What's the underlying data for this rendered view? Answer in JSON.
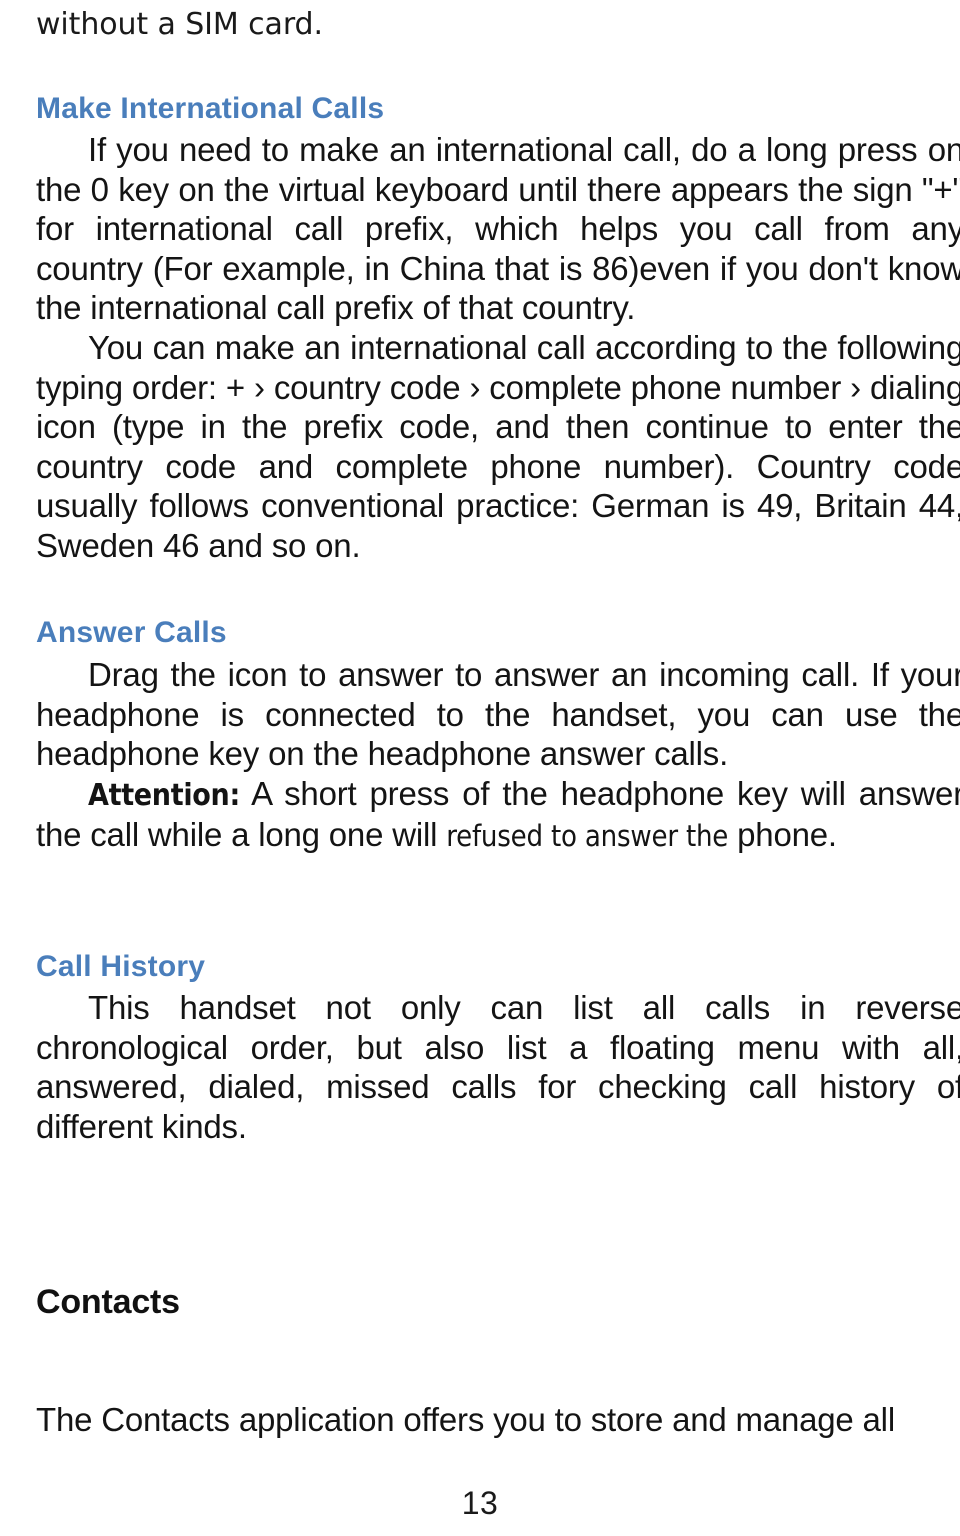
{
  "document": {
    "page_number": "13",
    "heading_color": "#4a7ebb",
    "body_color": "#141414",
    "background_color": "#ffffff"
  },
  "content": {
    "orphan_line": "without a SIM card.",
    "sections": [
      {
        "id": "make-international-calls",
        "heading": "Make International Calls",
        "heading_style": "blue",
        "paragraphs": [
          "If you need to make an international call, do a long press on the 0 key on the virtual keyboard until there appears the sign \"+\" for international call prefix, which helps you call from any country (For example, in China that is 86)even if you don't know the international call prefix of that country.",
          "You can make an international call according to the following typing order: + › country code › complete phone number › dialing icon (type in the prefix code, and then continue to enter the country code and complete phone number). Country code usually follows conventional practice: German is 49, Britain 44, Sweden 46 and so on."
        ]
      },
      {
        "id": "answer-calls",
        "heading": "Answer Calls",
        "heading_style": "blue",
        "paragraphs": [
          "Drag the icon to answer to answer an incoming call. If your headphone is connected to the handset, you can use the headphone key on the headphone answer calls."
        ],
        "attention": {
          "label": "Attention:",
          "text_run_1": " A short press of the headphone key will answer the call while a long one will ",
          "text_run_soft": "refused to answer the",
          "text_run_2": " phone."
        }
      },
      {
        "id": "call-history",
        "heading": "Call History",
        "heading_style": "blue",
        "paragraphs": [
          "This handset not only can list all calls in reverse chronological order, but also list a floating menu with all, answered, dialed, missed calls for checking call history of different kinds."
        ]
      },
      {
        "id": "contacts",
        "heading": "Contacts",
        "heading_style": "black",
        "paragraphs": [
          "The Contacts application offers you to store and manage all"
        ]
      }
    ]
  }
}
